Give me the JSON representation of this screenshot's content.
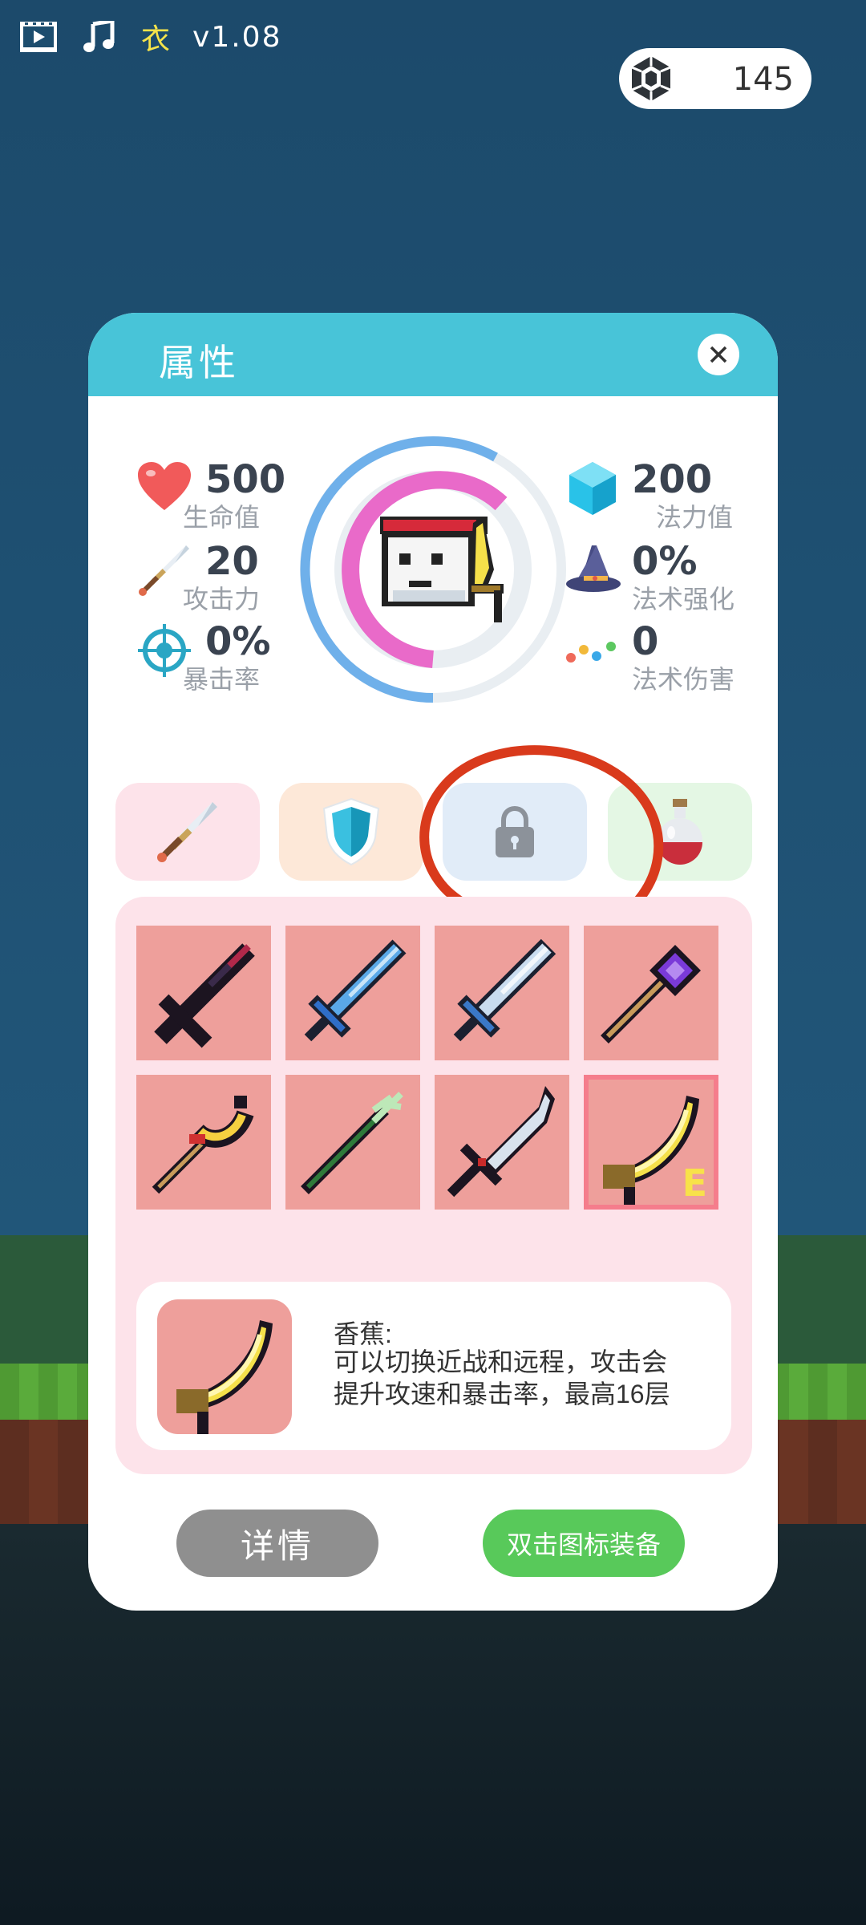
{
  "topbar": {
    "cloth_label": "衣",
    "version": "v1.08",
    "gems_count": "145"
  },
  "panel": {
    "title": "属性",
    "close_icon": "close-icon"
  },
  "stats": {
    "hp": {
      "value": "500",
      "label": "生命值"
    },
    "attack": {
      "value": "20",
      "label": "攻击力"
    },
    "crit": {
      "value": "0%",
      "label": "暴击率"
    },
    "mana": {
      "value": "200",
      "label": "法力值"
    },
    "spell_boost": {
      "value": "0%",
      "label": "法术强化"
    },
    "spell_damage": {
      "value": "0",
      "label": "法术伤害"
    }
  },
  "tabs": [
    "sword-icon",
    "shield-icon",
    "lock-icon",
    "potion-icon"
  ],
  "items": [
    "dark-crossbow",
    "blue-sword",
    "ice-sword",
    "purple-staff",
    "golden-scepter",
    "green-staff",
    "silver-blade",
    "banana"
  ],
  "equipped_mark": "E",
  "selected_item": {
    "name": "香蕉:",
    "line1": "可以切换近战和远程，攻击会",
    "line2": "提升攻速和暴击率，最高16层"
  },
  "buttons": {
    "detail": "详情",
    "equip": "双击图标装备"
  },
  "colors": {
    "header": "#48c4d8",
    "slot": "#ee9f9b",
    "equip_button": "#58c95a",
    "detail_button": "#8f8f8f",
    "annotation": "#d93a1c"
  }
}
